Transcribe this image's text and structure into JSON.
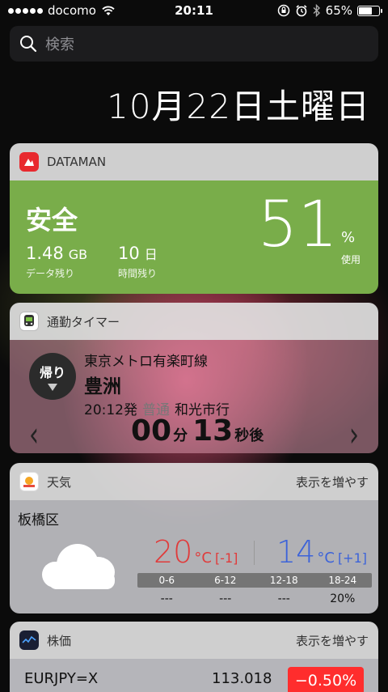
{
  "status_bar": {
    "carrier": "docomo",
    "time": "20:11",
    "battery": "65%",
    "battery_level": 0.65
  },
  "search": {
    "placeholder": "検索"
  },
  "date": "10月22日土曜日",
  "widgets": {
    "dataman": {
      "app_name": "DATAMAN",
      "status": "安全",
      "data_left_value": "1.48",
      "data_left_unit": "GB",
      "data_left_label": "データ残り",
      "days_left_value": "10",
      "days_left_unit": "日",
      "days_left_label": "時間残り",
      "percent_value": "51",
      "percent_sign": "%",
      "percent_label": "使用",
      "accent_color": "#79ad4a"
    },
    "commute": {
      "app_name": "通勤タイマー",
      "direction": "帰り",
      "line": "東京メトロ有楽町線",
      "station": "豊洲",
      "departure": "20:12",
      "departure_suffix": "発",
      "train_type": "普通",
      "destination": "和光市行",
      "minutes": "00",
      "minutes_unit": "分",
      "seconds": "13",
      "seconds_unit": "秒後"
    },
    "weather": {
      "app_name": "天気",
      "more": "表示を増やす",
      "location": "板橋区",
      "icon": "cloud-icon",
      "high": "20",
      "high_unit": "°C",
      "high_diff": "[-1]",
      "low": "14",
      "low_unit": "°C",
      "low_diff": "[+1]",
      "precip_periods": [
        "0-6",
        "6-12",
        "12-18",
        "18-24"
      ],
      "precip_values": [
        "---",
        "---",
        "---",
        "20%"
      ],
      "high_color": "#e03b3b",
      "low_color": "#3c63d9"
    },
    "stocks": {
      "app_name": "株価",
      "more": "表示を増やす",
      "symbol": "EURJPY=X",
      "price": "113.018",
      "change": "−0.50%",
      "change_color": "#ff2d2d"
    }
  }
}
